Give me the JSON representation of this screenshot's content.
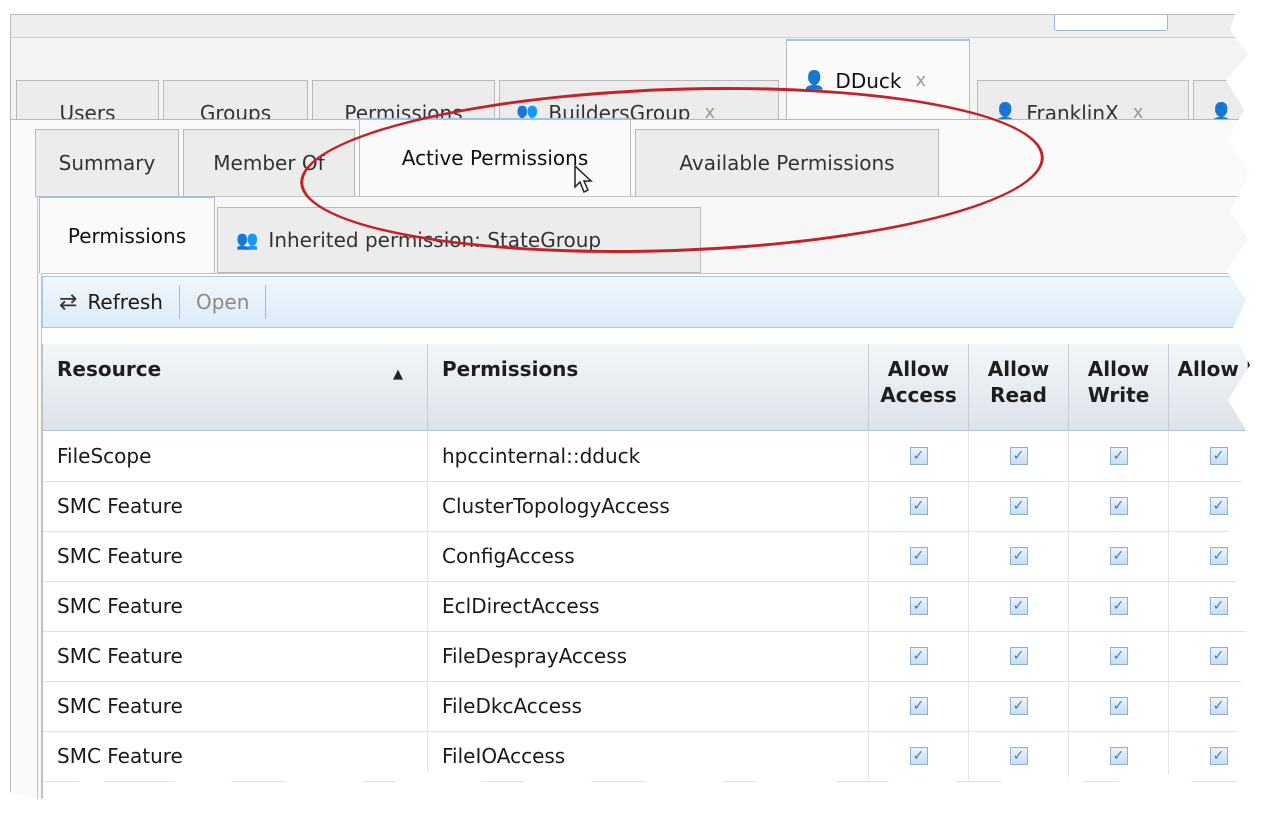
{
  "main_tabs": [
    {
      "label": "Users",
      "icon": "",
      "closable": false,
      "active": false
    },
    {
      "label": "Groups",
      "icon": "",
      "closable": false,
      "active": false
    },
    {
      "label": "Permissions",
      "icon": "",
      "closable": false,
      "active": false
    },
    {
      "label": "BuildersGroup",
      "icon": "group-icon",
      "closable": true,
      "active": false
    },
    {
      "label": "DDuck",
      "icon": "user-icon",
      "closable": true,
      "active": true
    },
    {
      "label": "FranklinX",
      "icon": "user-icon",
      "closable": true,
      "active": false
    }
  ],
  "close_glyph": "x",
  "user_tabs": [
    {
      "label": "Summary",
      "active": false
    },
    {
      "label": "Member Of",
      "active": false
    },
    {
      "label": "Active Permissions",
      "active": true
    },
    {
      "label": "Available Permissions",
      "active": false
    }
  ],
  "perm_tabs": [
    {
      "label": "Permissions",
      "active": true
    },
    {
      "label": "Inherited permission: StateGroup",
      "icon": "group-icon",
      "active": false
    }
  ],
  "toolbar": {
    "refresh_label": "Refresh",
    "open_label": "Open"
  },
  "grid": {
    "columns": [
      {
        "label": "Resource",
        "sorted": "ascending"
      },
      {
        "label": "Permissions"
      },
      {
        "label": "Allow Access"
      },
      {
        "label": "Allow Read"
      },
      {
        "label": "Allow Write"
      },
      {
        "label": "Allow F"
      }
    ],
    "rows": [
      {
        "resource": "FileScope",
        "permission": "hpccinternal::dduck",
        "checks": [
          true,
          true,
          true,
          true
        ]
      },
      {
        "resource": "SMC Feature",
        "permission": "ClusterTopologyAccess",
        "checks": [
          true,
          true,
          true,
          true
        ]
      },
      {
        "resource": "SMC Feature",
        "permission": "ConfigAccess",
        "checks": [
          true,
          true,
          true,
          true
        ]
      },
      {
        "resource": "SMC Feature",
        "permission": "EclDirectAccess",
        "checks": [
          true,
          true,
          true,
          true
        ]
      },
      {
        "resource": "SMC Feature",
        "permission": "FileDesprayAccess",
        "checks": [
          true,
          true,
          true,
          true
        ]
      },
      {
        "resource": "SMC Feature",
        "permission": "FileDkcAccess",
        "checks": [
          true,
          true,
          true,
          true
        ]
      },
      {
        "resource": "SMC Feature",
        "permission": "FileIOAccess",
        "checks": [
          true,
          true,
          true,
          true
        ]
      }
    ]
  },
  "colors": {
    "highlight_ellipse": "#c0232a",
    "toolbar_bg": "#dcebf8",
    "checkbox": "#3d7ab8"
  }
}
